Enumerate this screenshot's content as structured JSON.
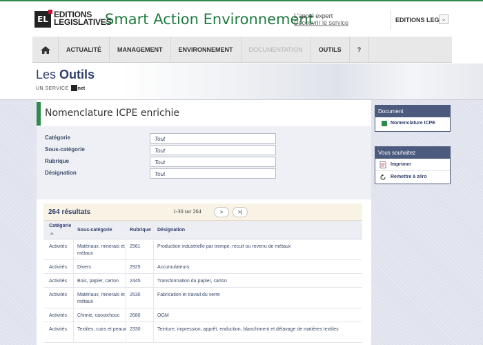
{
  "header": {
    "logo_mark": "EL",
    "logo_line1": "EDITIONS",
    "logo_line2": "LEGISLATIVES",
    "site_title": "Smart Action Environnement",
    "expert_label": "L'appel expert",
    "expert_link": "Découvrir le service",
    "account_name": "EDITIONS LEGI...",
    "account_chevron": "⌄"
  },
  "nav": {
    "home_icon": "home-icon",
    "items": [
      {
        "label": "ACTUALITÉ",
        "disabled": false
      },
      {
        "label": "MANAGEMENT",
        "disabled": false
      },
      {
        "label": "ENVIRONNEMENT",
        "disabled": false
      },
      {
        "label": "DOCUMENTATION",
        "disabled": true
      },
      {
        "label": "OUTILS",
        "disabled": false
      },
      {
        "label": "?",
        "disabled": false
      }
    ]
  },
  "banner": {
    "les": "Les",
    "outils": "Outils",
    "service_prefix": "UN SERVICE",
    "service_brand": "net"
  },
  "page": {
    "title": "Nomenclature ICPE enrichie"
  },
  "filters": [
    {
      "label": "Catégorie",
      "value": "Tout"
    },
    {
      "label": "Sous-catégorie",
      "value": "Tout"
    },
    {
      "label": "Rubrique",
      "value": "Tout"
    },
    {
      "label": "Désignation",
      "value": "Tout"
    }
  ],
  "results": {
    "count_label": "264 résultats",
    "page_info": "1-30 sur 264",
    "next_label": ">",
    "last_label": ">|"
  },
  "table": {
    "headers": [
      "Catégorie",
      "Sous-catégorie",
      "Rubrique",
      "Désignation"
    ],
    "rows": [
      [
        "Activités",
        "Matériaux, minerais et métaux",
        "2561",
        "Production industrielle par trempe, recuit ou revenu de métaux"
      ],
      [
        "Activités",
        "Divers",
        "2925",
        "Accumulateurs"
      ],
      [
        "Activités",
        "Bois, papier, carton",
        "2445",
        "Transformation du papier, carton"
      ],
      [
        "Activités",
        "Matériaux, minerais et métaux",
        "2530",
        "Fabrication et travail du verre"
      ],
      [
        "Activités",
        "Chimie, caoutchouc",
        "2680",
        "OGM"
      ],
      [
        "Activités",
        "Textiles, cuirs et peaux",
        "2330",
        "Teinture, impression, apprêt, enduction, blanchiment et délavage de matières textiles"
      ]
    ]
  },
  "sidebar": {
    "document_title": "Document",
    "document_item": "Nomenclature ICPE",
    "actions_title": "Vous souhaitez",
    "actions": [
      {
        "label": "Imprimer",
        "icon": "print-icon"
      },
      {
        "label": "Remettre à zéro",
        "icon": "reset-icon"
      }
    ]
  },
  "colors": {
    "brand_green": "#2c8a4a",
    "navy": "#4c5a7e",
    "results_bg": "#f8f3e5"
  }
}
